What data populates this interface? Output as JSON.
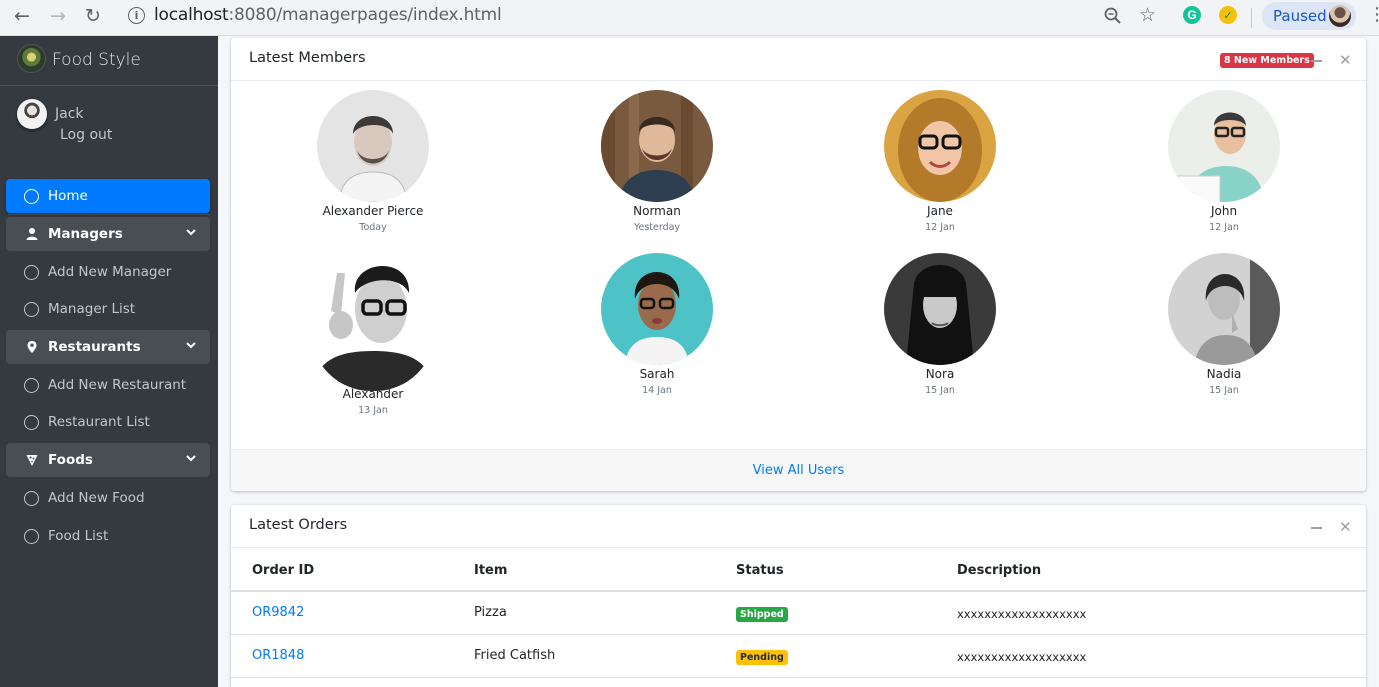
{
  "browser": {
    "url_host": "localhost",
    "url_rest": ":8080/managerpages/index.html",
    "profile_label": "Paused",
    "ext1_label": "G"
  },
  "sidebar": {
    "brand": "Food Style",
    "user_name": "Jack",
    "logout_label": "Log out",
    "items": [
      {
        "label": "Home",
        "type": "link",
        "active": true
      },
      {
        "label": "Managers",
        "type": "section",
        "icon": "user-icon"
      },
      {
        "label": "Add New Manager",
        "type": "link"
      },
      {
        "label": "Manager List",
        "type": "link"
      },
      {
        "label": "Restaurants",
        "type": "section",
        "icon": "map-marker-icon"
      },
      {
        "label": "Add New Restaurant",
        "type": "link"
      },
      {
        "label": "Restaurant List",
        "type": "link"
      },
      {
        "label": "Foods",
        "type": "section",
        "icon": "pizza-icon"
      },
      {
        "label": "Add New Food",
        "type": "link"
      },
      {
        "label": "Food List",
        "type": "link"
      }
    ]
  },
  "members_card": {
    "title": "Latest Members",
    "badge": "8 New Members",
    "members": [
      {
        "name": "Alexander Pierce",
        "date": "Today"
      },
      {
        "name": "Norman",
        "date": "Yesterday"
      },
      {
        "name": "Jane",
        "date": "12 Jan"
      },
      {
        "name": "John",
        "date": "12 Jan"
      },
      {
        "name": "Alexander",
        "date": "13 Jan"
      },
      {
        "name": "Sarah",
        "date": "14 Jan"
      },
      {
        "name": "Nora",
        "date": "15 Jan"
      },
      {
        "name": "Nadia",
        "date": "15 Jan"
      }
    ],
    "footer_link": "View All Users"
  },
  "orders_card": {
    "title": "Latest Orders",
    "columns": [
      "Order ID",
      "Item",
      "Status",
      "Description"
    ],
    "rows": [
      {
        "order_id": "OR9842",
        "item": "Pizza",
        "status": "Shipped",
        "description": "xxxxxxxxxxxxxxxxxxx"
      },
      {
        "order_id": "OR1848",
        "item": "Fried Catfish",
        "status": "Pending",
        "description": "xxxxxxxxxxxxxxxxxxx"
      }
    ]
  },
  "colors": {
    "sidebar_bg": "#343a40",
    "primary": "#007bff",
    "danger": "#dc3545",
    "success": "#28a745",
    "warning": "#ffc107"
  }
}
